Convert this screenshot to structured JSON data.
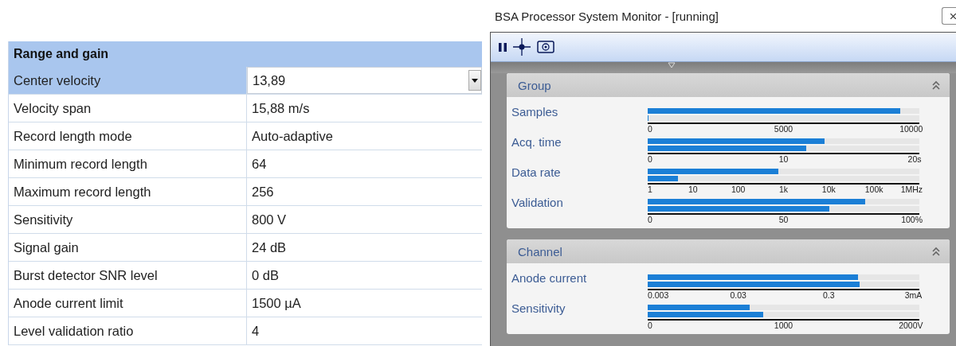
{
  "properties": {
    "section": "Range and gain",
    "rows": [
      {
        "name": "Center velocity",
        "value": "13,89",
        "selected": true
      },
      {
        "name": "Velocity span",
        "value": "15,88 m/s",
        "selected": false
      },
      {
        "name": "Record length mode",
        "value": "Auto-adaptive",
        "selected": false
      },
      {
        "name": "Minimum record length",
        "value": "64",
        "selected": false
      },
      {
        "name": "Maximum record length",
        "value": "256",
        "selected": false
      },
      {
        "name": "Sensitivity",
        "value": "800 V",
        "selected": false
      },
      {
        "name": "Signal gain",
        "value": "24 dB",
        "selected": false
      },
      {
        "name": "Burst detector SNR level",
        "value": "0 dB",
        "selected": false
      },
      {
        "name": "Anode current limit",
        "value": "1500 µA",
        "selected": false
      },
      {
        "name": "Level validation ratio",
        "value": "4",
        "selected": false
      }
    ]
  },
  "monitor": {
    "title": "BSA Processor System Monitor - [running]",
    "groups": [
      {
        "title": "Group",
        "expanded": true,
        "meters": [
          {
            "label": "Samples",
            "bars": [
              {
                "level": 0.93
              },
              {
                "level": 0.004
              }
            ],
            "ticks": [
              "0",
              "5000",
              "10000"
            ]
          },
          {
            "label": "Acq. time",
            "bars": [
              {
                "level": 0.65
              },
              {
                "level": 0.585
              }
            ],
            "ticks": [
              "0",
              "10",
              "20s"
            ]
          },
          {
            "label": "Data rate",
            "bars": [
              {
                "level": 0.48
              },
              {
                "level": 0.11
              }
            ],
            "ticks": [
              "1",
              "10",
              "100",
              "1k",
              "10k",
              "100k",
              "1MHz"
            ]
          },
          {
            "label": "Validation",
            "bars": [
              {
                "level": 0.8
              },
              {
                "level": 0.67
              }
            ],
            "ticks": [
              "0",
              "50",
              "100%"
            ]
          }
        ]
      },
      {
        "title": "Channel",
        "expanded": true,
        "meters": [
          {
            "label": "Anode current",
            "bars": [
              {
                "level": 0.775
              },
              {
                "level": 0.78
              }
            ],
            "ticks": [
              "0.003",
              "0.03",
              "0.3",
              "3mA"
            ]
          },
          {
            "label": "Sensitivity",
            "bars": [
              {
                "level": 0.375
              },
              {
                "level": 0.425
              }
            ],
            "ticks": [
              "0",
              "1000",
              "2000V"
            ]
          }
        ]
      }
    ]
  }
}
